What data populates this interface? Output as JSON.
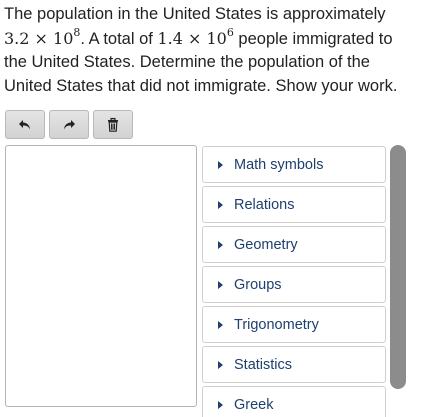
{
  "question": {
    "line1": "The population in the United States is approximately",
    "m1_base": "3.2 × 10",
    "m1_exp": "8",
    "mid": ". A total of ",
    "m2_base": "1.4 × 10",
    "m2_exp": "6",
    "rest": " people immigrated to the United States. Determine the population of the United States that did not immigrate. Show your work."
  },
  "toolbar": {
    "undo_icon": "undo-icon",
    "redo_icon": "redo-icon",
    "delete_icon": "trash-icon"
  },
  "editor": {
    "value": ""
  },
  "palette": {
    "items": [
      {
        "label": "Math symbols"
      },
      {
        "label": "Relations"
      },
      {
        "label": "Geometry"
      },
      {
        "label": "Groups"
      },
      {
        "label": "Trigonometry"
      },
      {
        "label": "Statistics"
      },
      {
        "label": "Greek"
      }
    ]
  },
  "colors": {
    "link": "#1f3f6e",
    "button_bg": "#d9d9d9",
    "scrollbar": "#8c8c8c"
  }
}
